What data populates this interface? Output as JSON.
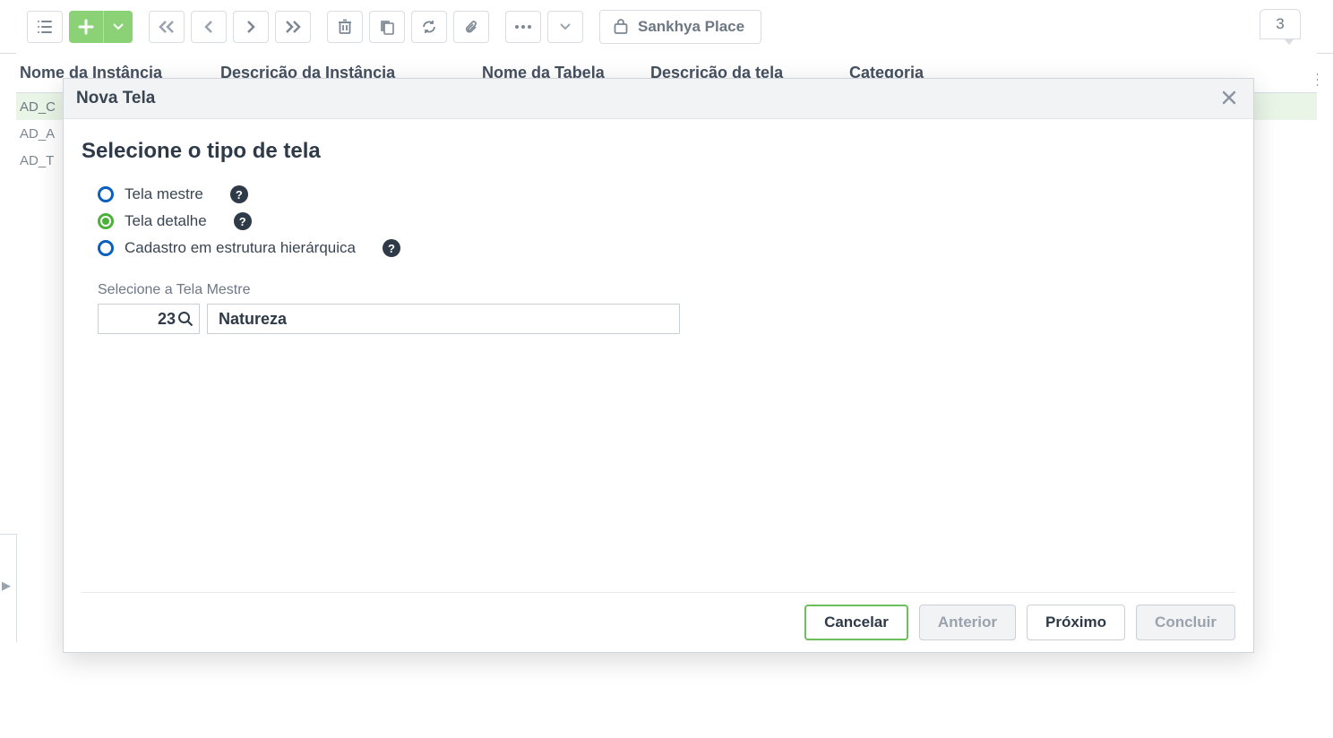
{
  "toolbar": {
    "sankhya_label": "Sankhya Place",
    "badge_count": "3"
  },
  "grid": {
    "headers": {
      "c1": "Nome da Instância",
      "c2": "Descrição da Instância",
      "c3": "Nome da Tabela",
      "c4": "Descrição da tela",
      "c5": "Categoria"
    },
    "rows": [
      {
        "c1": "AD_C"
      },
      {
        "c1": "AD_A"
      },
      {
        "c1": "AD_T"
      }
    ],
    "selected_index": 0
  },
  "modal": {
    "title": "Nova Tela",
    "section_title": "Selecione o tipo de tela",
    "radios": {
      "mestre": "Tela mestre",
      "detalhe": "Tela detalhe",
      "hier": "Cadastro em estrutura hierárquica"
    },
    "selected_radio": "detalhe",
    "master_field_label": "Selecione a Tela Mestre",
    "master_code": "23",
    "master_name": "Natureza",
    "buttons": {
      "cancel": "Cancelar",
      "prev": "Anterior",
      "next": "Próximo",
      "finish": "Concluir"
    }
  }
}
